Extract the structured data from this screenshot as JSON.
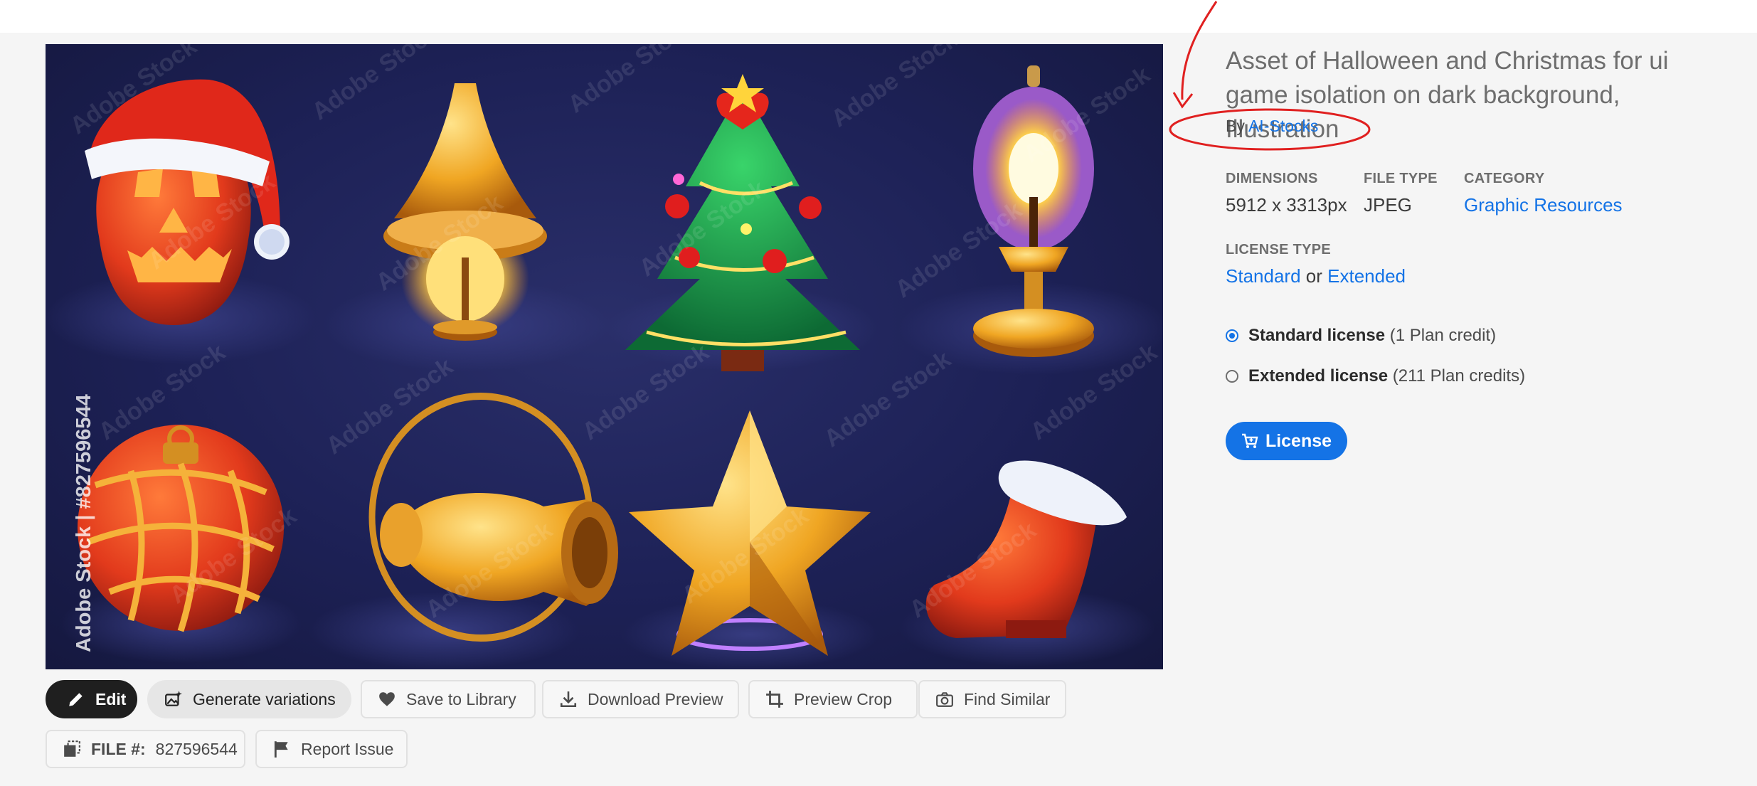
{
  "preview": {
    "watermark": "Adobe Stock",
    "side_credit": "Adobe Stock | #827596544"
  },
  "toolbar": {
    "edit": "Edit",
    "generate": "Generate variations",
    "save": "Save to Library",
    "download": "Download Preview",
    "crop": "Preview Crop",
    "find_similar": "Find Similar",
    "file_label": "FILE #:",
    "file_number": "827596544",
    "report": "Report Issue"
  },
  "details": {
    "title": "Asset of Halloween and Christmas for ui game isolation on dark background, Illustration",
    "by_prefix": "By",
    "author": "AI-Stocks",
    "dimensions_label": "DIMENSIONS",
    "dimensions_value": "5912 x 3313px",
    "filetype_label": "FILE TYPE",
    "filetype_value": "JPEG",
    "category_label": "CATEGORY",
    "category_value": "Graphic Resources",
    "license_type_label": "LICENSE TYPE",
    "license_standard": "Standard",
    "license_or": "or",
    "license_extended": "Extended",
    "option_standard_name": "Standard license",
    "option_standard_credit": "(1 Plan credit)",
    "option_extended_name": "Extended license",
    "option_extended_credit": "(211 Plan credits)",
    "selected_option": "standard",
    "license_button": "License"
  },
  "colors": {
    "accent": "#1473e6",
    "annotation": "#e02020",
    "image_background": "#1d2156"
  }
}
